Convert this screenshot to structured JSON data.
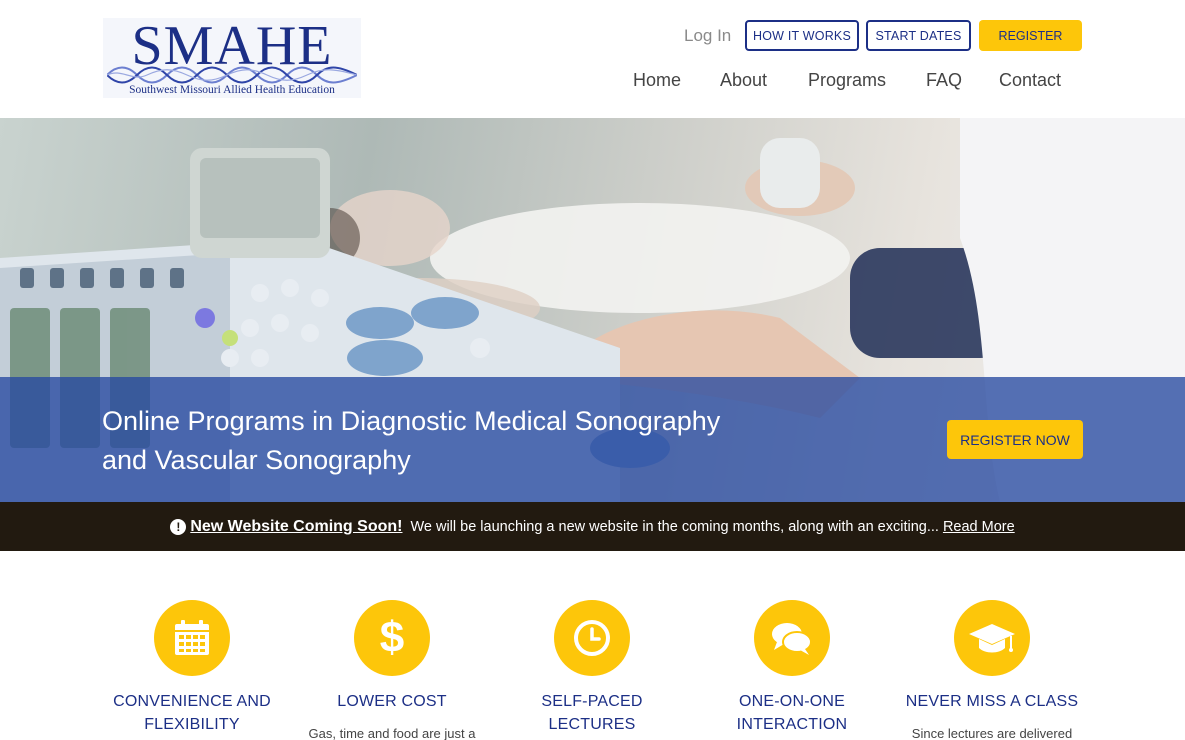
{
  "header": {
    "logo_text": "SMAHE",
    "logo_subtitle": "Southwest Missouri Allied Health Education",
    "login_label": "Log In",
    "how_it_works_label": "HOW IT WORKS",
    "start_dates_label": "START DATES",
    "register_label": "REGISTER"
  },
  "nav": {
    "items": [
      {
        "label": "Home"
      },
      {
        "label": "About"
      },
      {
        "label": "Programs"
      },
      {
        "label": "FAQ"
      },
      {
        "label": "Contact"
      }
    ]
  },
  "hero": {
    "title_line1": "Online Programs in Diagnostic Medical Sonography",
    "title_line2": "and Vascular Sonography",
    "register_now_label": "REGISTER NOW"
  },
  "notice": {
    "icon": "exclamation-circle-icon",
    "headline": "New Website Coming Soon!",
    "text": "We will be launching a new website in the coming months, along with an exciting...",
    "read_more_label": "Read More"
  },
  "features": [
    {
      "icon": "calendar-icon",
      "title_line1": "CONVENIENCE AND",
      "title_line2": "FLEXIBILITY",
      "desc": ""
    },
    {
      "icon": "dollar-icon",
      "title_line1": "LOWER COST",
      "title_line2": "",
      "desc": "Gas, time and food are just a"
    },
    {
      "icon": "clock-icon",
      "title_line1": "SELF-PACED",
      "title_line2": "LECTURES",
      "desc": ""
    },
    {
      "icon": "chat-bubbles-icon",
      "title_line1": "ONE-ON-ONE",
      "title_line2": "INTERACTION",
      "desc": ""
    },
    {
      "icon": "graduation-cap-icon",
      "title_line1": "NEVER MISS A CLASS",
      "title_line2": "",
      "desc": "Since lectures are delivered"
    }
  ],
  "colors": {
    "brand_blue": "#1c2f86",
    "accent_yellow": "#fdc60a",
    "notice_bg": "#221a10",
    "hero_band": "#2649a0"
  }
}
